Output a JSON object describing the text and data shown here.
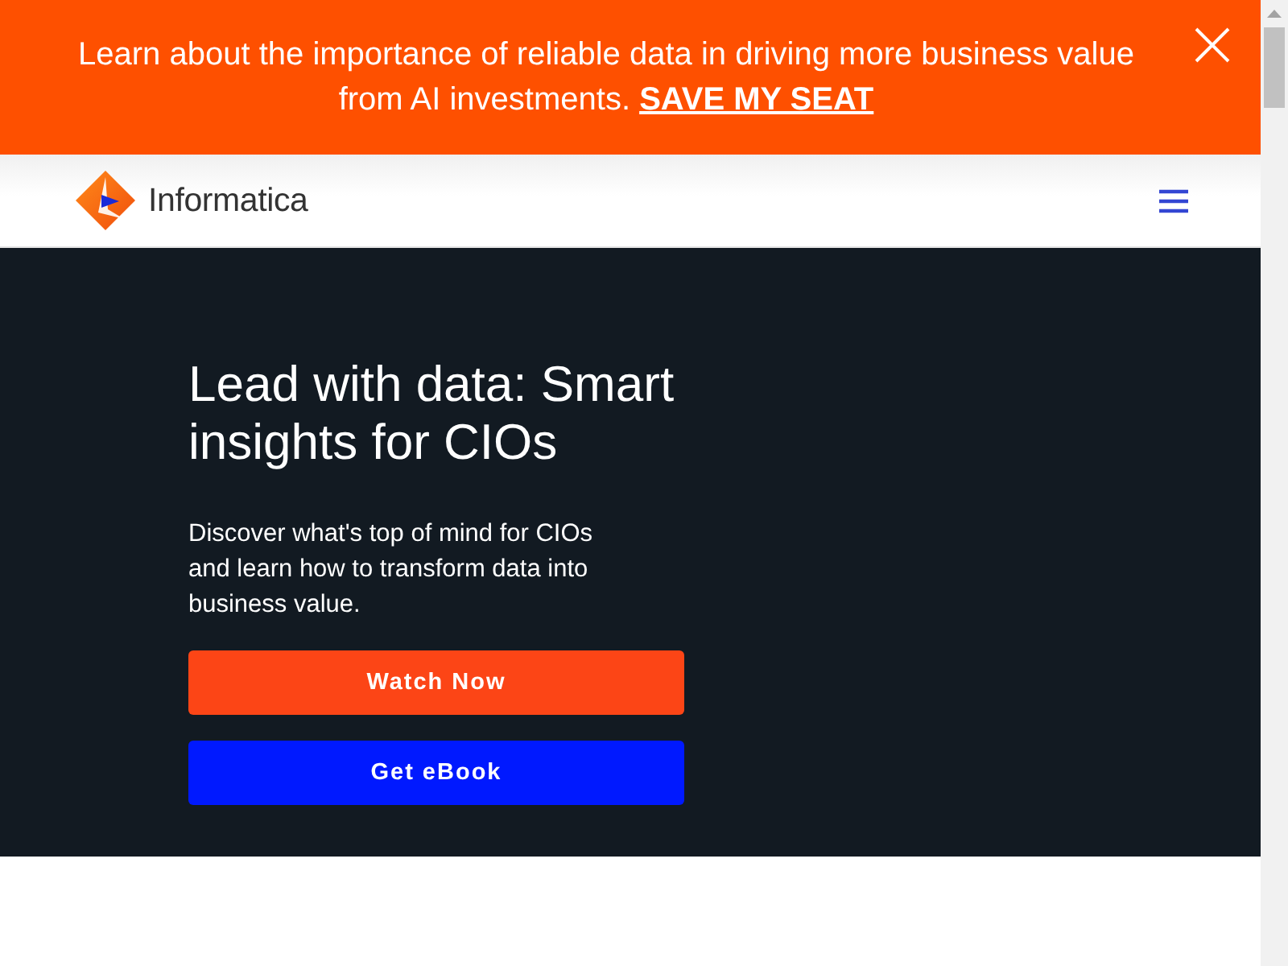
{
  "banner": {
    "text": "Learn about the importance of reliable data in driving more business value from AI investments.",
    "link": "SAVE MY SEAT"
  },
  "header": {
    "logo_text": "Informatica"
  },
  "hero": {
    "title": "Lead with data: Smart insights for CIOs",
    "description": "Discover what's top of mind for CIOs and learn how to transform data into business value.",
    "buttons": [
      {
        "label": "Watch Now",
        "kind": "primary"
      },
      {
        "label": "Get eBook",
        "kind": "secondary"
      }
    ]
  }
}
